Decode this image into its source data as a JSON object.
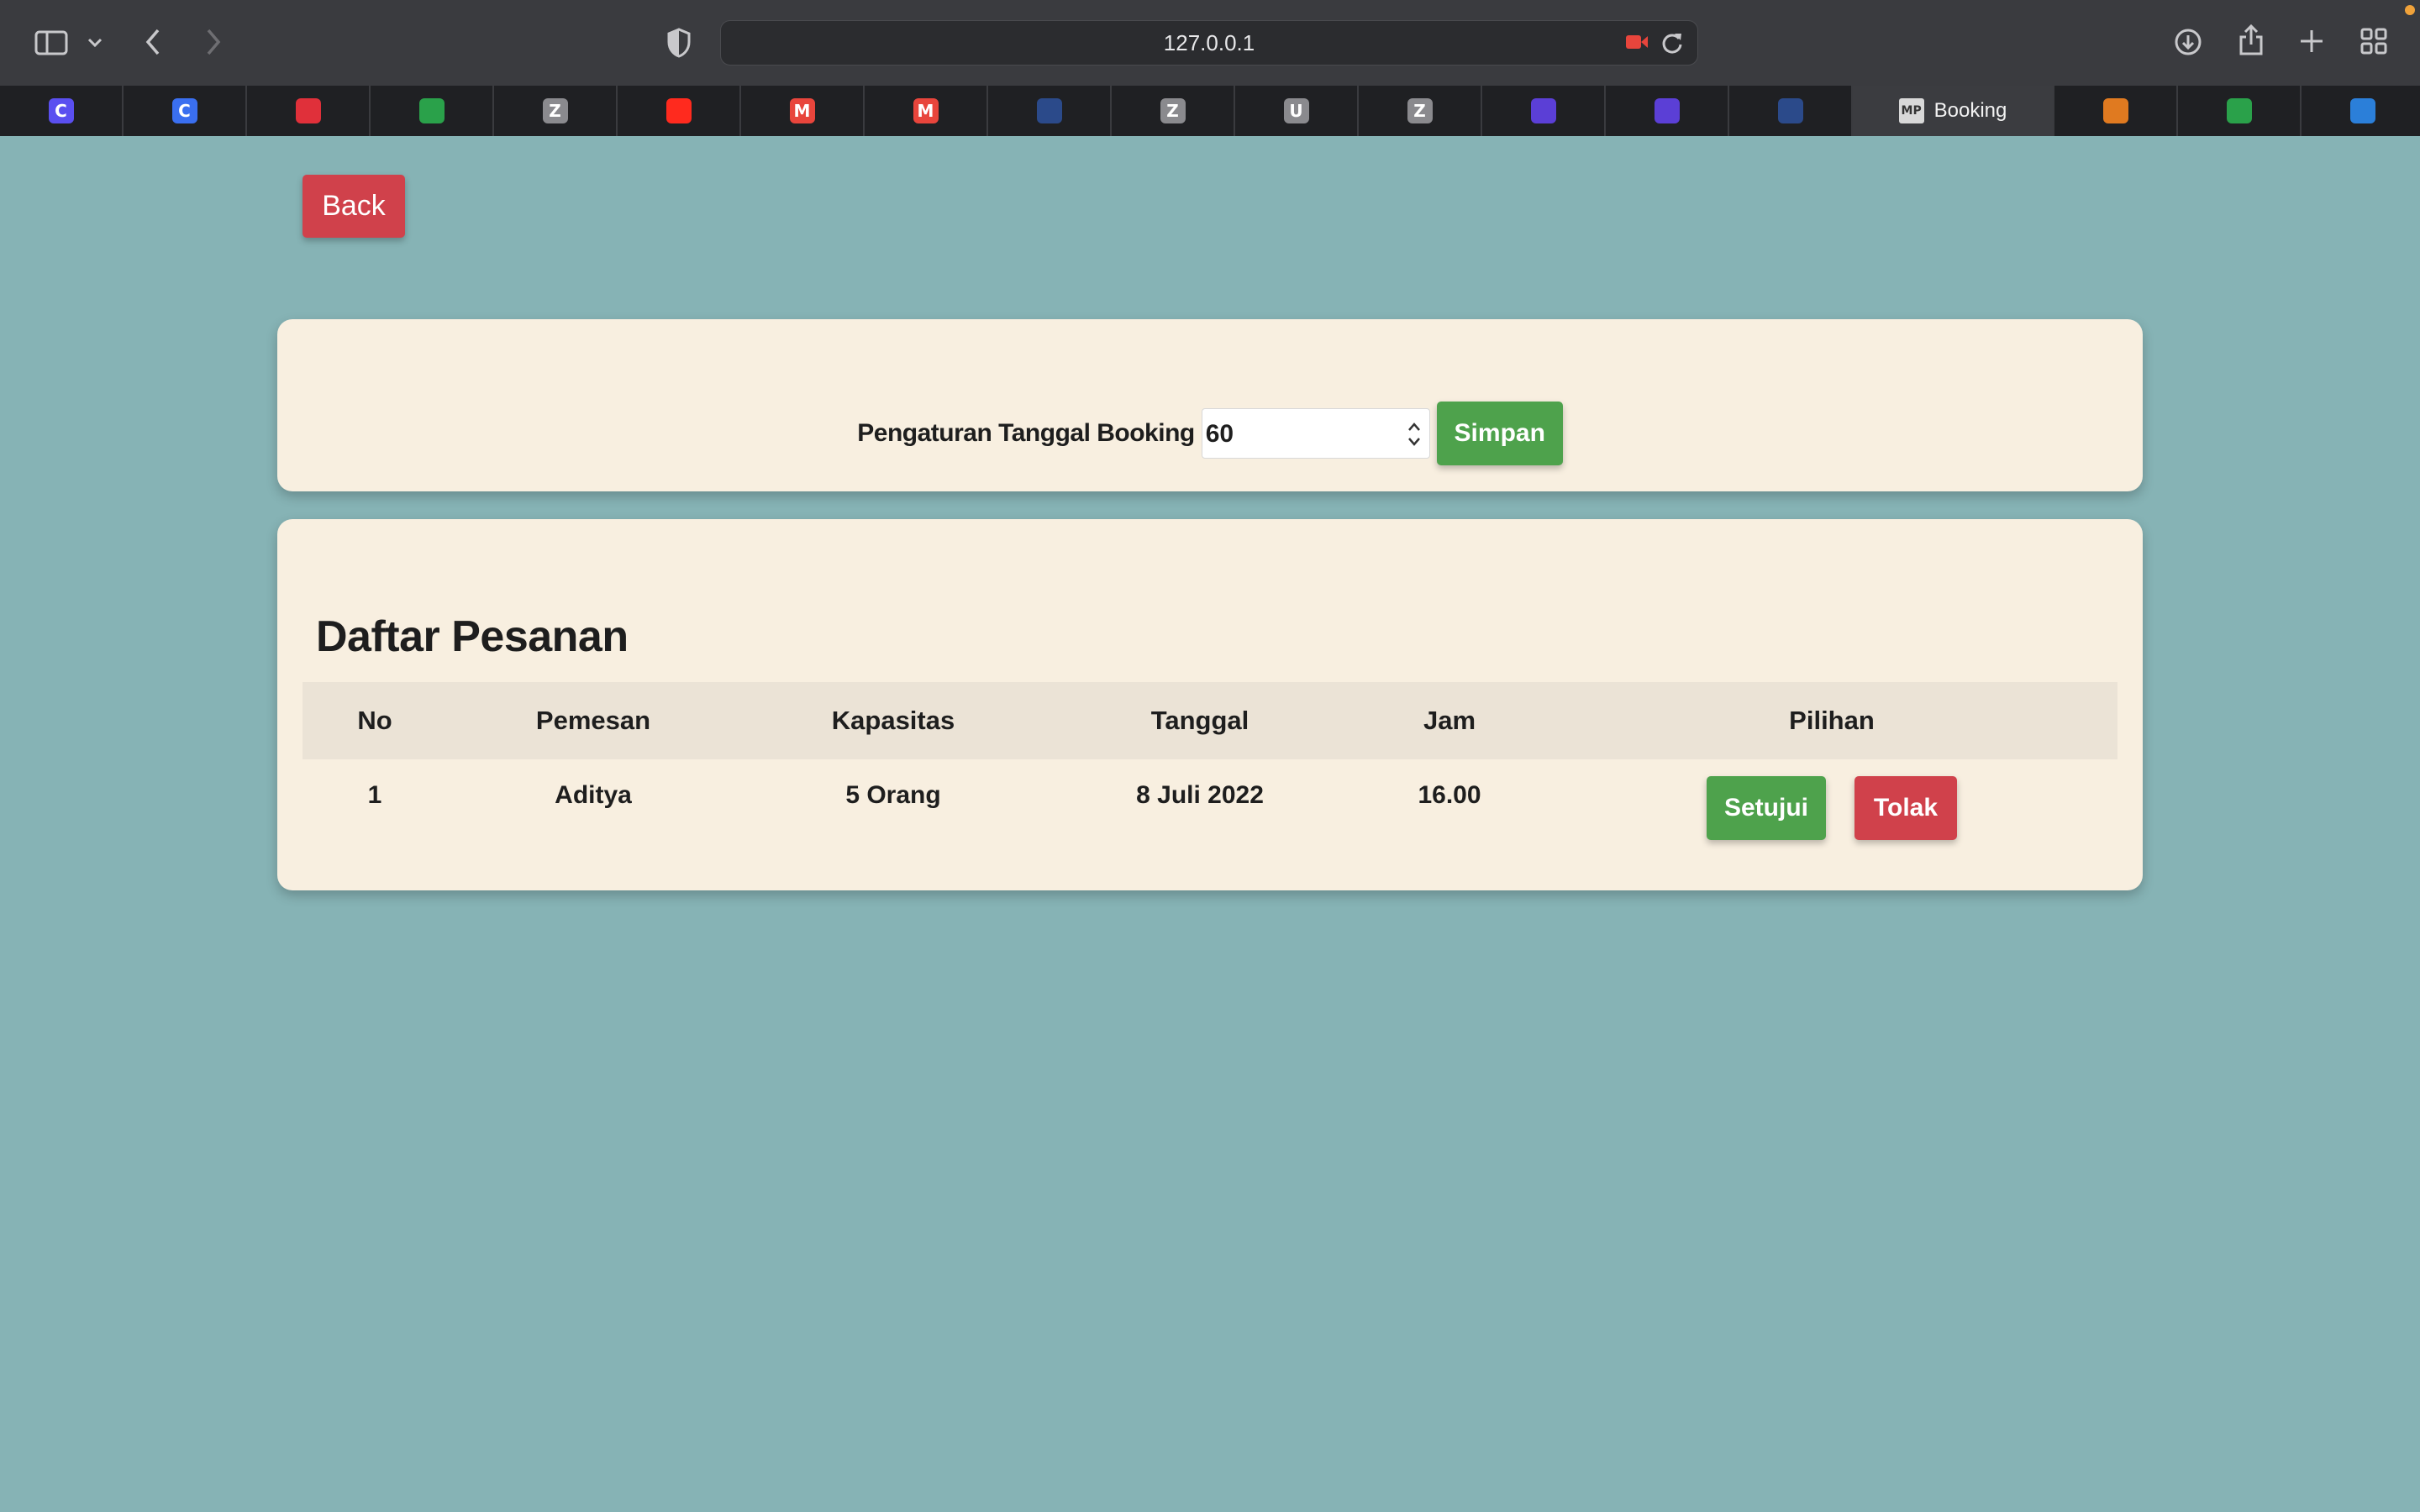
{
  "browser": {
    "url": "127.0.0.1",
    "active_tab_title": "Booking",
    "tabs": [
      {
        "icon": "canva-icon",
        "letter": "C",
        "color": "#5a4ff0"
      },
      {
        "icon": "canva-icon",
        "letter": "C",
        "color": "#3a6ff0"
      },
      {
        "icon": "heart-icon",
        "letter": "",
        "color": "#e0303a"
      },
      {
        "icon": "google-meet-icon",
        "letter": "",
        "color": "#2aa14a"
      },
      {
        "icon": "zoom-icon",
        "letter": "Z",
        "color": "#8a8a8e"
      },
      {
        "icon": "youtube-icon",
        "letter": "",
        "color": "#ff2a1e"
      },
      {
        "icon": "gmail-icon",
        "letter": "M",
        "color": "#e8453c"
      },
      {
        "icon": "gmail-icon",
        "letter": "M",
        "color": "#e8453c"
      },
      {
        "icon": "unhas-logo-icon",
        "letter": "",
        "color": "#2b4a8a"
      },
      {
        "icon": "zoom-icon",
        "letter": "Z",
        "color": "#8a8a8e"
      },
      {
        "icon": "u-icon",
        "letter": "U",
        "color": "#8a8a8e"
      },
      {
        "icon": "zoom-icon",
        "letter": "Z",
        "color": "#8a8a8e"
      },
      {
        "icon": "list-icon",
        "letter": "",
        "color": "#5b3fd6"
      },
      {
        "icon": "list-icon",
        "letter": "",
        "color": "#5b3fd6"
      },
      {
        "icon": "unhas-logo-icon",
        "letter": "",
        "color": "#2b4a8a"
      },
      {
        "icon": "mp-icon",
        "letter": "MP",
        "color": "#d8d8d8",
        "active": true
      },
      {
        "icon": "mountain-logo-icon",
        "letter": "",
        "color": "#e07a20"
      },
      {
        "icon": "google-meet-icon",
        "letter": "",
        "color": "#2aa14a"
      },
      {
        "icon": "trello-icon",
        "letter": "",
        "color": "#2b7fd9"
      }
    ]
  },
  "page": {
    "back_label": "Back",
    "settings": {
      "label": "Pengaturan Tanggal Booking",
      "value": "60",
      "save_label": "Simpan"
    },
    "orders": {
      "title": "Daftar Pesanan",
      "columns": [
        "No",
        "Pemesan",
        "Kapasitas",
        "Tanggal",
        "Jam",
        "Pilihan"
      ],
      "rows": [
        {
          "no": "1",
          "pemesan": "Aditya",
          "kapasitas": "5 Orang",
          "tanggal": "8 Juli 2022",
          "jam": "16.00",
          "approve_label": "Setujui",
          "reject_label": "Tolak"
        }
      ]
    }
  },
  "colors": {
    "background": "#86b3b5",
    "card": "#f8efe0",
    "table_header": "#ebe3d6",
    "green": "#4ea24c",
    "red": "#d0414b"
  }
}
